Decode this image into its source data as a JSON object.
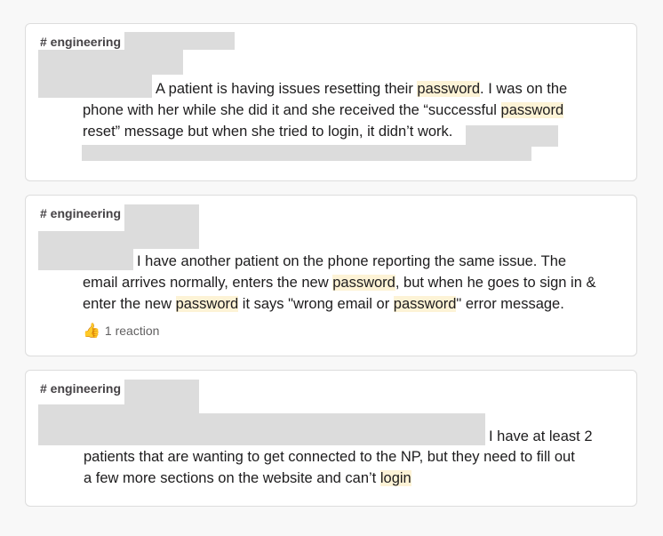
{
  "messages": [
    {
      "channel": "# engineering",
      "lines": [
        {
          "a": "A patient is having issues resetting their ",
          "hl": "password",
          "b": ". I was on the"
        },
        {
          "a": "phone with her while she did it and she received the “successful ",
          "hl": "password",
          "b": ""
        },
        {
          "a": "reset” message but when she tried to login, it didn’t work.",
          "hl": "",
          "b": ""
        }
      ]
    },
    {
      "channel": "# engineering",
      "lines": [
        {
          "a": "I have another patient on the phone reporting the same issue. The",
          "hl": "",
          "b": ""
        },
        {
          "a": "email arrives normally, enters the new ",
          "hl": "password",
          "b": ", but when he goes to sign in &"
        },
        {
          "a": "enter the new ",
          "hl": "password",
          "b": " it says \"wrong email or ",
          "hl2": "password",
          "c": "\" error message."
        }
      ],
      "reaction": {
        "icon": "👍",
        "label": "1 reaction"
      }
    },
    {
      "channel": "# engineering",
      "lines": [
        {
          "a": "I have at least 2",
          "hl": "",
          "b": ""
        },
        {
          "a": "patients that are wanting to get connected to the NP, but they need to fill out",
          "hl": "",
          "b": ""
        },
        {
          "a": "a few more sections on the website and can’t ",
          "hl": "login",
          "b": ""
        }
      ]
    }
  ]
}
